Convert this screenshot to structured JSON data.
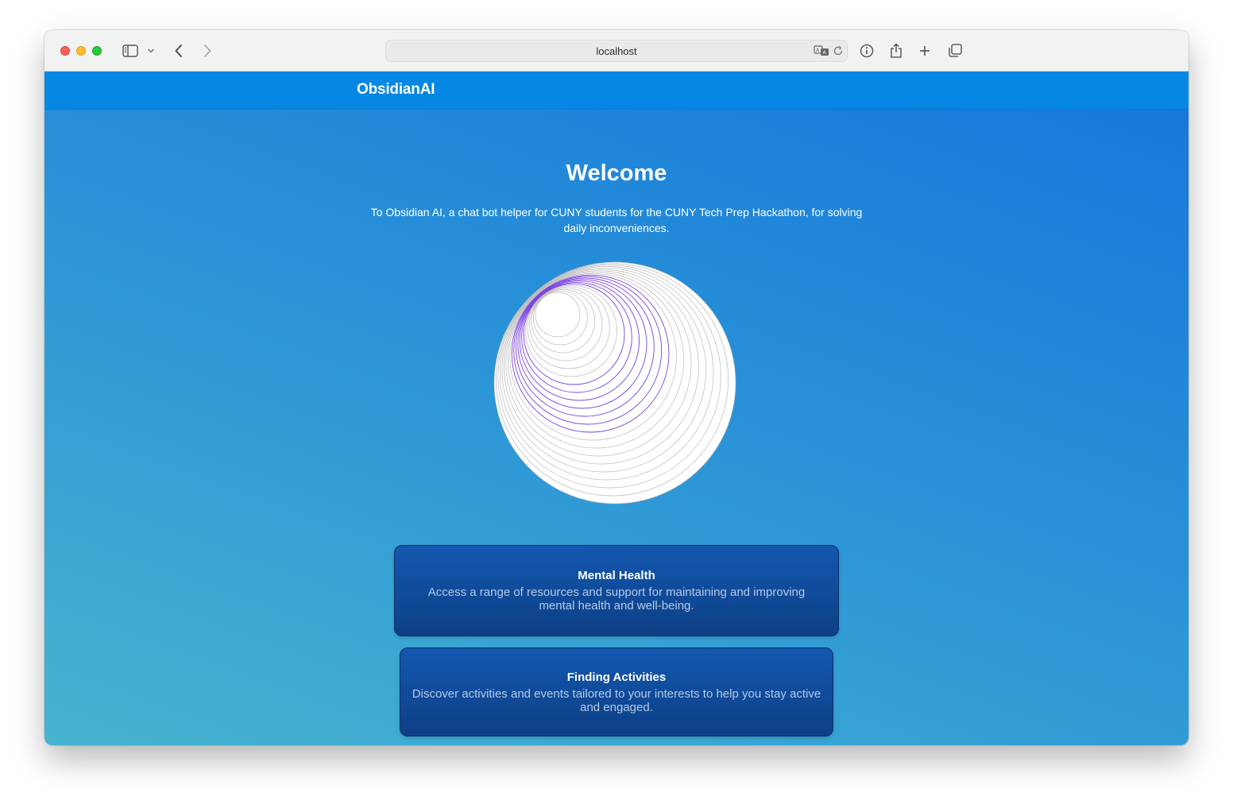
{
  "browser": {
    "url": "localhost"
  },
  "app": {
    "brand": "ObsidianAI"
  },
  "hero": {
    "title": "Welcome",
    "intro": "To Obsidian AI, a chat bot helper for CUNY students for the CUNY Tech Prep Hackathon, for solving daily inconveniences."
  },
  "cards": [
    {
      "title": "Mental Health",
      "description": "Access a range of resources and support for maintaining and improving mental health and well-being."
    },
    {
      "title": "Finding Activities",
      "description": "Discover activities and events tailored to your interests to help you stay active and engaged."
    }
  ],
  "colors": {
    "navbar": "#0687e3",
    "card": "#1358b0",
    "orb_accent": "#7b3fe4"
  },
  "icons": [
    "sidebar-toggle-icon",
    "chevron-down-icon",
    "back-icon",
    "forward-icon",
    "translate-icon",
    "reload-icon",
    "info-icon",
    "share-icon",
    "new-tab-icon",
    "tab-overview-icon"
  ]
}
